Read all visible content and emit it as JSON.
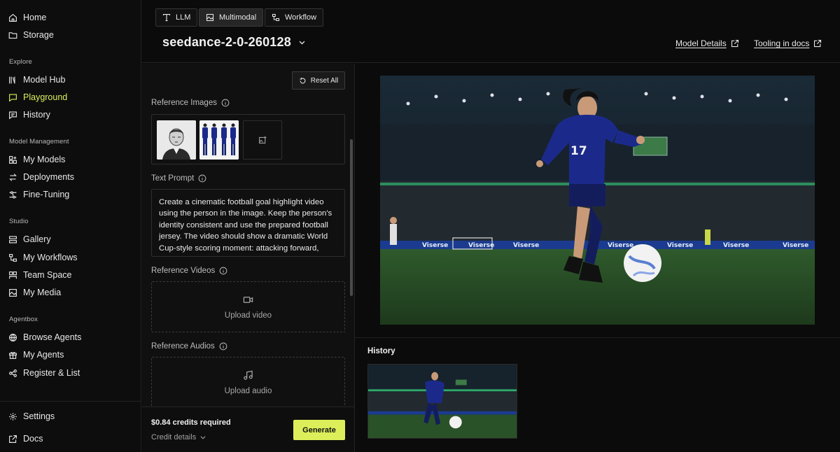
{
  "sidebar": {
    "top": [
      {
        "label": "Home",
        "icon": "home-icon"
      },
      {
        "label": "Storage",
        "icon": "folder-icon"
      }
    ],
    "sections": [
      {
        "title": "Explore",
        "items": [
          {
            "label": "Model Hub",
            "icon": "library-icon"
          },
          {
            "label": "Playground",
            "icon": "chat-icon",
            "active": true
          },
          {
            "label": "History",
            "icon": "chat-history-icon"
          }
        ]
      },
      {
        "title": "Model Management",
        "items": [
          {
            "label": "My Models",
            "icon": "grid-plus-icon"
          },
          {
            "label": "Deployments",
            "icon": "arrows-icon"
          },
          {
            "label": "Fine-Tuning",
            "icon": "tune-icon"
          }
        ]
      },
      {
        "title": "Studio",
        "items": [
          {
            "label": "Gallery",
            "icon": "stack-icon"
          },
          {
            "label": "My Workflows",
            "icon": "workflow-icon"
          },
          {
            "label": "Team Space",
            "icon": "team-icon"
          },
          {
            "label": "My Media",
            "icon": "image-icon"
          }
        ]
      },
      {
        "title": "Agentbox",
        "items": [
          {
            "label": "Browse Agents",
            "icon": "globe-icon"
          },
          {
            "label": "My Agents",
            "icon": "gift-icon"
          },
          {
            "label": "Register & List",
            "icon": "nodes-icon"
          }
        ]
      }
    ],
    "bottom": [
      {
        "label": "Settings",
        "icon": "gear-icon"
      },
      {
        "label": "Docs",
        "icon": "external-link-icon"
      }
    ]
  },
  "header": {
    "modes": [
      {
        "label": "LLM",
        "icon": "text-icon"
      },
      {
        "label": "Multimodal",
        "icon": "image-icon",
        "active": true
      },
      {
        "label": "Workflow",
        "icon": "workflow-icon"
      }
    ],
    "model_name": "seedance-2-0-260128",
    "links": [
      {
        "label": "Model Details",
        "icon": "external-link-icon"
      },
      {
        "label": "Tooling in docs",
        "icon": "external-link-icon"
      }
    ]
  },
  "panel": {
    "reset_label": "Reset All",
    "reference_images_label": "Reference Images",
    "text_prompt_label": "Text Prompt",
    "prompt_text": "Create a cinematic football goal highlight video using the person in the image. Keep the person's identity consistent and use the prepared football jersey. The video should show a dramatic World Cup-style scoring moment: attacking forward, taking the shot, scoring the goal, celebrating with",
    "reference_videos_label": "Reference Videos",
    "upload_video_label": "Upload video",
    "reference_audios_label": "Reference Audios",
    "upload_audio_label": "Upload audio",
    "credits_required": "$0.84 credits required",
    "credit_details_label": "Credit details",
    "generate_label": "Generate"
  },
  "preview": {
    "history_label": "History",
    "jersey_number": "17",
    "board_text": "Viserse"
  },
  "colors": {
    "accent": "#dcef5a",
    "background": "#0a0a0a",
    "jersey": "#1b2a8a"
  }
}
